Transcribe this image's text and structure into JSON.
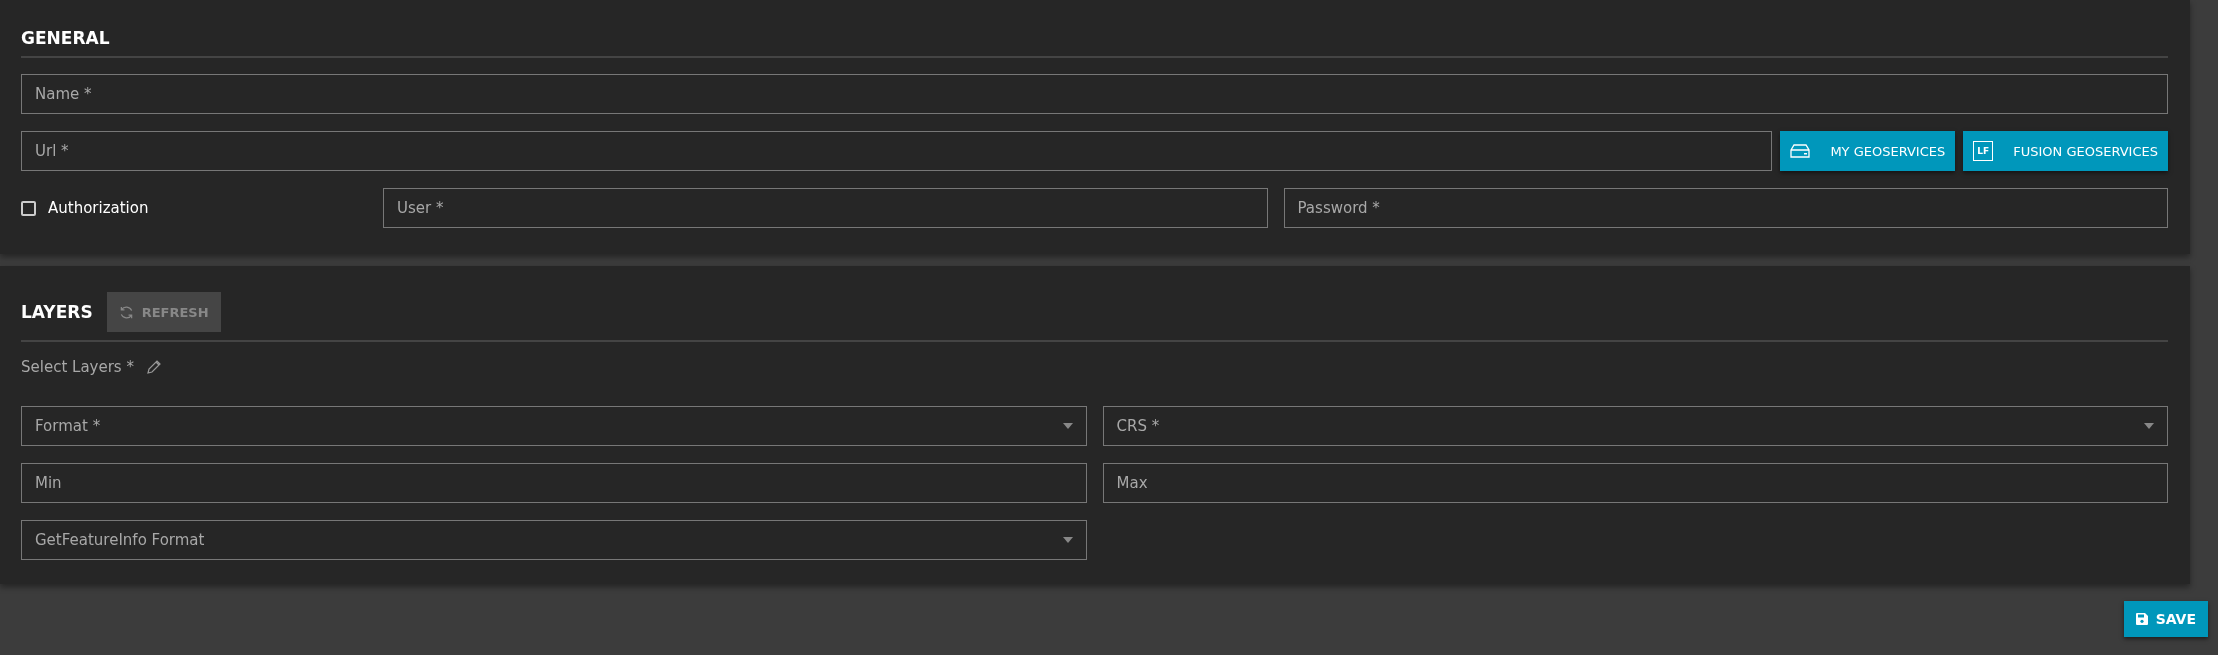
{
  "general": {
    "title": "GENERAL",
    "name_field": {
      "placeholder": "Name *"
    },
    "url_field": {
      "placeholder": "Url *"
    },
    "buttons": [
      {
        "label": "MY GEOSERVICES",
        "kind": "drive"
      },
      {
        "label": "FUSION GEOSERVICES",
        "kind": "logo",
        "logo_text": "LF"
      }
    ],
    "authorization": {
      "label": "Authorization",
      "checked": false
    },
    "user_field": {
      "placeholder": "User *"
    },
    "password_field": {
      "placeholder": "Password *"
    }
  },
  "layers": {
    "title": "LAYERS",
    "refresh": {
      "label": "REFRESH",
      "disabled": true
    },
    "select_layers": {
      "label": "Select Layers *"
    },
    "fields": [
      {
        "kind": "select",
        "placeholder": "Format *"
      },
      {
        "kind": "select",
        "placeholder": "CRS *"
      },
      {
        "kind": "text",
        "placeholder": "Min"
      },
      {
        "kind": "text",
        "placeholder": "Max"
      },
      {
        "kind": "select",
        "placeholder": "GetFeatureInfo Format"
      }
    ]
  },
  "footer": {
    "save": {
      "label": "SAVE"
    }
  }
}
